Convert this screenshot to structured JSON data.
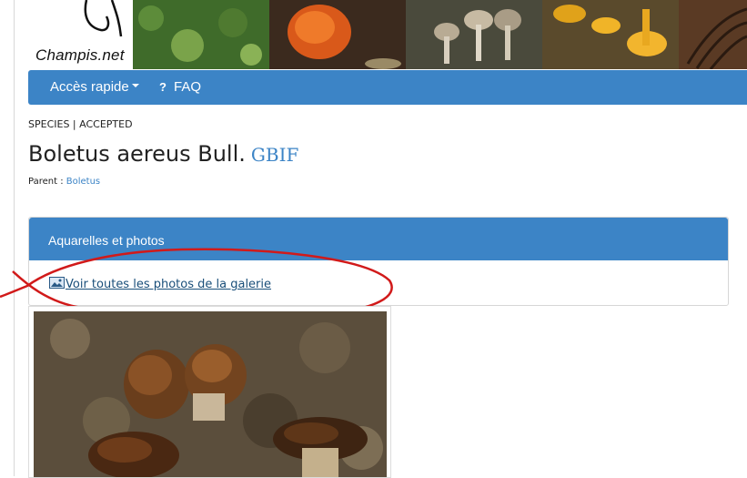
{
  "site": {
    "logo_text": "Champis.net"
  },
  "nav": {
    "quick_access": "Accès rapide",
    "faq": "FAQ"
  },
  "taxon": {
    "rank_status": "SPECIES | ACCEPTED",
    "name": "Boletus aereus Bull.",
    "gbif_link": "GBIF",
    "parent_label": "Parent :",
    "parent_value": "Boletus"
  },
  "panel": {
    "heading": "Aquarelles et photos",
    "gallery_link": "Voir toutes les photos de la galerie"
  },
  "colors": {
    "brand_blue": "#3c84c6",
    "annotation_red": "#d11a1a"
  },
  "icons": {
    "faq": "question-icon",
    "gallery": "image-icon",
    "dropdown": "caret-down-icon"
  }
}
